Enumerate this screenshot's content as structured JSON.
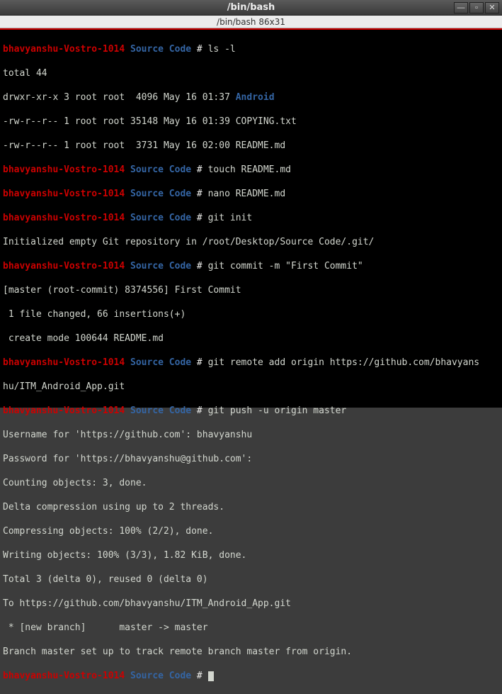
{
  "window": {
    "title": "/bin/bash",
    "status": "/bin/bash 86x31"
  },
  "host": "bhavyanshu-Vostro-1014",
  "dir": "Source Code",
  "prompt_sep": " # ",
  "lines": {
    "cmd1": "ls -l",
    "out1": "total 44",
    "out2a": "drwxr-xr-x 3 root root  4096 May 16 01:37 ",
    "out2b": "Android",
    "out3": "-rw-r--r-- 1 root root 35148 May 16 01:39 COPYING.txt",
    "out4": "-rw-r--r-- 1 root root  3731 May 16 02:00 README.md",
    "cmd2": "touch README.md",
    "cmd3": "nano README.md",
    "cmd4": "git init",
    "out5": "Initialized empty Git repository in /root/Desktop/Source Code/.git/",
    "cmd5": "git commit -m \"First Commit\"",
    "out6": "[master (root-commit) 8374556] First Commit",
    "out7": " 1 file changed, 66 insertions(+)",
    "out8": " create mode 100644 README.md",
    "cmd6": "git remote add origin https://github.com/bhavyans",
    "cmd6b": "hu/ITM_Android_App.git",
    "cmd7": "git push -u origin master",
    "out9": "Username for 'https://github.com': bhavyanshu",
    "out10": "Password for 'https://bhavyanshu@github.com': ",
    "out11": "Counting objects: 3, done.",
    "out12": "Delta compression using up to 2 threads.",
    "out13": "Compressing objects: 100% (2/2), done.",
    "out14": "Writing objects: 100% (3/3), 1.82 KiB, done.",
    "out15": "Total 3 (delta 0), reused 0 (delta 0)",
    "out16": "To https://github.com/bhavyanshu/ITM_Android_App.git",
    "out17": " * [new branch]      master -> master",
    "out18": "Branch master set up to track remote branch master from origin."
  }
}
